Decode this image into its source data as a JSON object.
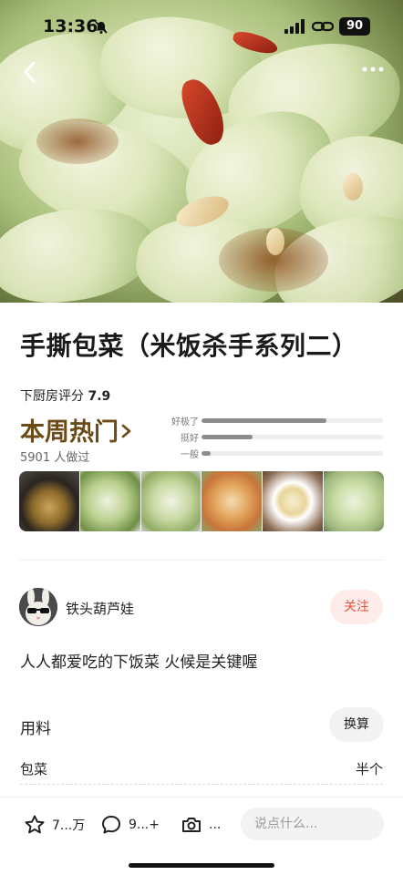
{
  "status_bar": {
    "time": "13:36",
    "battery": "90"
  },
  "recipe": {
    "title": "手撕包菜（米饭杀手系列二）",
    "score_label": "下厨房评分",
    "score_value": "7.9",
    "hot_label": "本周热门",
    "made_count": "5901 人做过",
    "ratings": [
      {
        "label": "好极了",
        "fraction": 0.69
      },
      {
        "label": "挺好",
        "fraction": 0.28
      },
      {
        "label": "一般",
        "fraction": 0.05
      }
    ],
    "gallery_count": 6
  },
  "author": {
    "name": "铁头葫芦娃",
    "follow_label": "关注"
  },
  "description": "人人都爱吃的下饭菜  火候是关键喔",
  "ingredients": {
    "title": "用料",
    "convert_label": "换算",
    "items": [
      {
        "name": "包菜",
        "amount": "半个"
      }
    ]
  },
  "bottom_bar": {
    "like_count": "7...万",
    "comment_count": "9...+",
    "photo_label": "...",
    "comment_placeholder": "说点什么..."
  },
  "colors": {
    "hot": "#6b4a18",
    "follow": "#e8503a",
    "follow_bg": "#fdecea"
  }
}
